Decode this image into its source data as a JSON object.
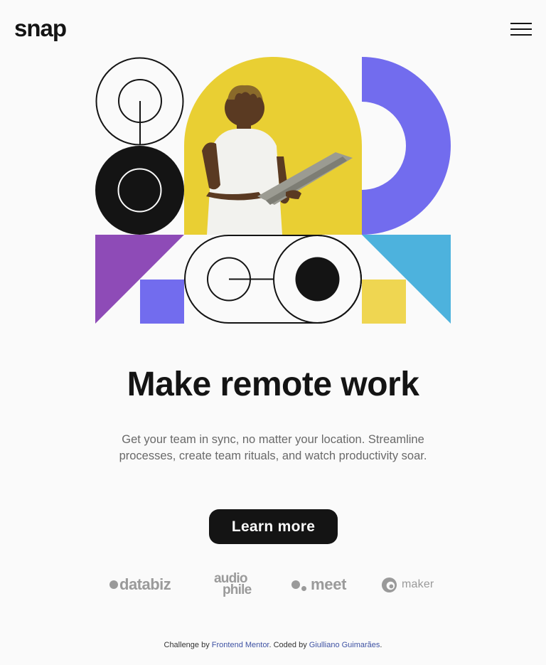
{
  "header": {
    "logo": "snap",
    "menu_icon": "hamburger-icon"
  },
  "hero": {
    "image_subject": "person-with-laptop",
    "colors": {
      "black": "#141414",
      "yellow": "#e9cf33",
      "purple": "#726cee",
      "violet": "#8e4bb7",
      "sky": "#4db2dd",
      "light_yellow": "#efd651",
      "outline": "#141414"
    }
  },
  "content": {
    "headline": "Make remote work",
    "subtext": "Get your team in sync, no matter your location. Streamline processes, create team rituals, and watch productivity soar.",
    "cta_label": "Learn more"
  },
  "clients": {
    "databiz": "databiz",
    "audiophile_line1": "audio",
    "audiophile_line2": "phile",
    "meet": "meet",
    "maker": "maker"
  },
  "attribution": {
    "prefix": "Challenge by",
    "mentor_link": "Frontend Mentor",
    "middle": ". Coded by",
    "author_link": "Giulliano Guimarães",
    "suffix": "."
  }
}
